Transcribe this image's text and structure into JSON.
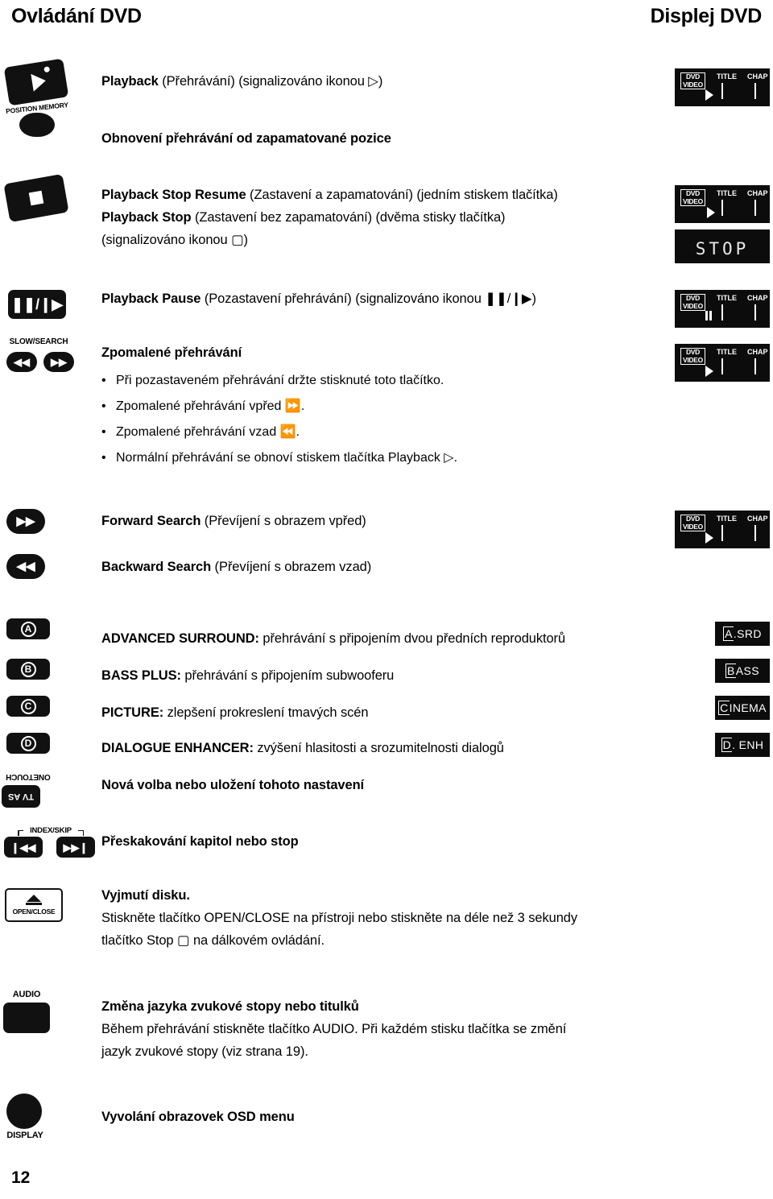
{
  "header": {
    "left_title": "Ovládání DVD",
    "right_title": "Displej DVD"
  },
  "page_number": "12",
  "controls": {
    "position_memory_label": "POSITION MEMORY",
    "slow_search_label": "SLOW/SEARCH",
    "onetouch_label": "ONETOUCH",
    "tv_as_label": "TV AS",
    "index_skip_label": "INDEX/SKIP",
    "open_close_label": "OPEN/CLOSE",
    "audio_label": "AUDIO",
    "display_label": "DISPLAY",
    "letter_a": "A",
    "letter_b": "B",
    "letter_c": "C",
    "letter_d": "D"
  },
  "sections": [
    {
      "id": "playback",
      "lines": [
        {
          "bold": "Playback",
          "rest": " (Přehrávání) (signalizováno ikonou ▷)"
        }
      ]
    },
    {
      "id": "resume",
      "lines": [
        {
          "bold": "Obnovení přehrávání od zapamatované pozice",
          "rest": ""
        }
      ]
    },
    {
      "id": "stop",
      "lines": [
        {
          "bold": "Playback Stop Resume",
          "rest": " (Zastavení a zapamatování) (jedním stiskem tlačítka)"
        },
        {
          "bold": "Playback Stop",
          "rest": " (Zastavení bez zapamatování) (dvěma stisky tlačítka)"
        },
        {
          "bold": "",
          "rest": "(signalizováno ikonou ▢)"
        }
      ]
    },
    {
      "id": "pause",
      "lines": [
        {
          "bold": "Playback Pause",
          "rest": " (Pozastavení přehrávání) (signalizováno ikonou ❚❚/❙▶)"
        }
      ]
    },
    {
      "id": "slow",
      "heading": "Zpomalené přehrávání",
      "bullets": [
        "Při pozastaveném přehrávání držte stisknuté toto tlačítko.",
        "Zpomalené přehrávání vpřed ⏩.",
        "Zpomalené přehrávání vzad ⏪.",
        "Normální přehrávání se obnoví stiskem tlačítka Playback ▷."
      ]
    },
    {
      "id": "forward-search",
      "lines": [
        {
          "bold": "Forward Search",
          "rest": " (Převíjení s obrazem vpřed)"
        }
      ]
    },
    {
      "id": "backward-search",
      "lines": [
        {
          "bold": "Backward Search",
          "rest": " (Převíjení s obrazem vzad)"
        }
      ]
    },
    {
      "id": "advanced-surround",
      "lines": [
        {
          "bold": "ADVANCED SURROUND:",
          "rest": " přehrávání s připojením dvou předních reproduktorů"
        }
      ]
    },
    {
      "id": "bass-plus",
      "lines": [
        {
          "bold": "BASS PLUS:",
          "rest": " přehrávání s připojením subwooferu"
        }
      ]
    },
    {
      "id": "picture",
      "lines": [
        {
          "bold": "PICTURE:",
          "rest": " zlepšení prokreslení tmavých scén"
        }
      ]
    },
    {
      "id": "dialogue-enhancer",
      "lines": [
        {
          "bold": "DIALOGUE ENHANCER:",
          "rest": " zvýšení hlasitosti a srozumitelnosti dialogů"
        }
      ]
    },
    {
      "id": "new-selection",
      "lines": [
        {
          "bold": "Nová volba nebo uložení tohoto nastavení",
          "rest": ""
        }
      ]
    },
    {
      "id": "skip",
      "lines": [
        {
          "bold": "Přeskakování kapitol nebo stop",
          "rest": ""
        }
      ]
    },
    {
      "id": "eject",
      "heading": "Vyjmutí disku.",
      "body": [
        "Stiskněte tlačítko OPEN/CLOSE na přístroji nebo stiskněte na déle než 3 sekundy",
        "tlačítko Stop ▢ na dálkovém ovládání."
      ]
    },
    {
      "id": "audio-language",
      "heading": "Změna jazyka zvukové stopy nebo titulků",
      "body": [
        "Během přehrávání stiskněte tlačítko AUDIO. Při každém stisku tlačítka se změní",
        "jazyk zvukové stopy (viz strana 19)."
      ]
    },
    {
      "id": "osd",
      "lines": [
        {
          "bold": "Vyvolání obrazovek OSD menu",
          "rest": ""
        }
      ]
    }
  ],
  "displays": {
    "dvd_label_line1": "DVD",
    "dvd_label_line2": "VIDEO",
    "title_label": "TITLE",
    "chap_label": "CHAP",
    "stop_text": "STOP",
    "modes": [
      {
        "lead": "A",
        "rest": ".SRD"
      },
      {
        "lead": "B",
        "rest": "ASS"
      },
      {
        "lead": "C",
        "rest": "INEMA"
      },
      {
        "lead": "D",
        "rest": ". ENH"
      }
    ]
  },
  "colors": {
    "ink": "#000000",
    "paper": "#ffffff",
    "display_bg": "#0c0c0c",
    "display_fg": "#ffffff"
  }
}
